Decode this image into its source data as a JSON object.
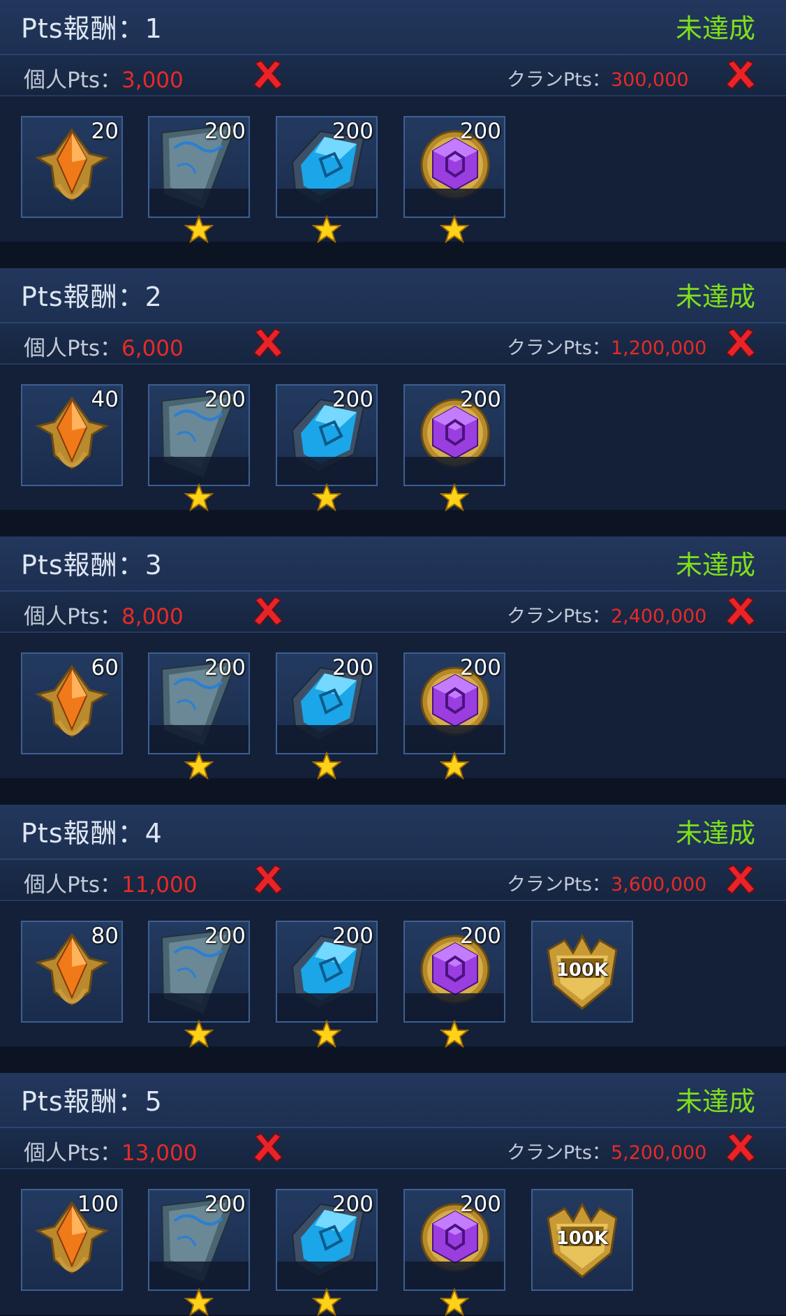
{
  "tier_prefix": "Pts報酬：",
  "status_label": "未達成",
  "personal_label": "個人Pts：",
  "clan_label": "クランPts：",
  "colors": {
    "status": "#7fe01c",
    "value": "#e82a27",
    "header_bg": "#22375c"
  },
  "tiers": [
    {
      "title": "Pts報酬：1",
      "status": "未達成",
      "personal_value": "3,000",
      "clan_value": "300,000",
      "items": [
        {
          "icon": "orange-crest-icon",
          "count": "20"
        },
        {
          "icon": "stone-shard-icon",
          "count": "200"
        },
        {
          "icon": "blue-crystal-icon",
          "count": "200"
        },
        {
          "icon": "purple-gem-icon",
          "count": "200"
        }
      ]
    },
    {
      "title": "Pts報酬：2",
      "status": "未達成",
      "personal_value": "6,000",
      "clan_value": "1,200,000",
      "items": [
        {
          "icon": "orange-crest-icon",
          "count": "40"
        },
        {
          "icon": "stone-shard-icon",
          "count": "200"
        },
        {
          "icon": "blue-crystal-icon",
          "count": "200"
        },
        {
          "icon": "purple-gem-icon",
          "count": "200"
        }
      ]
    },
    {
      "title": "Pts報酬：3",
      "status": "未達成",
      "personal_value": "8,000",
      "clan_value": "2,400,000",
      "items": [
        {
          "icon": "orange-crest-icon",
          "count": "60"
        },
        {
          "icon": "stone-shard-icon",
          "count": "200"
        },
        {
          "icon": "blue-crystal-icon",
          "count": "200"
        },
        {
          "icon": "purple-gem-icon",
          "count": "200"
        }
      ]
    },
    {
      "title": "Pts報酬：4",
      "status": "未達成",
      "personal_value": "11,000",
      "clan_value": "3,600,000",
      "items": [
        {
          "icon": "orange-crest-icon",
          "count": "80"
        },
        {
          "icon": "stone-shard-icon",
          "count": "200"
        },
        {
          "icon": "blue-crystal-icon",
          "count": "200"
        },
        {
          "icon": "purple-gem-icon",
          "count": "200"
        },
        {
          "icon": "gold-100k-badge-icon",
          "badge": "100K"
        }
      ]
    },
    {
      "title": "Pts報酬：5",
      "status": "未達成",
      "personal_value": "13,000",
      "clan_value": "5,200,000",
      "items": [
        {
          "icon": "orange-crest-icon",
          "count": "100"
        },
        {
          "icon": "stone-shard-icon",
          "count": "200"
        },
        {
          "icon": "blue-crystal-icon",
          "count": "200"
        },
        {
          "icon": "purple-gem-icon",
          "count": "200"
        },
        {
          "icon": "gold-100k-badge-icon",
          "badge": "100K"
        }
      ]
    }
  ]
}
